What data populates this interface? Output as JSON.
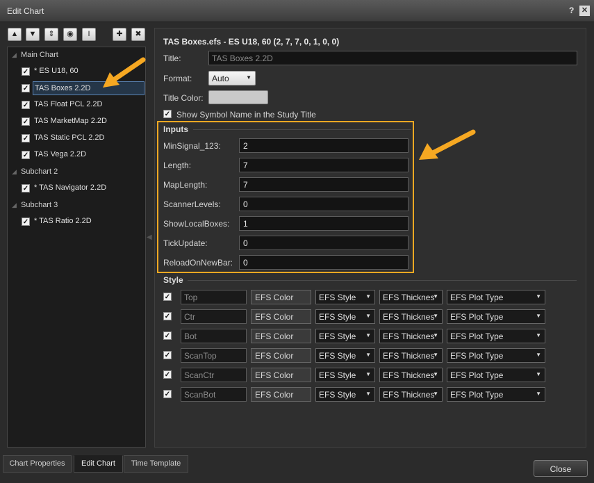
{
  "window": {
    "title": "Edit Chart",
    "help_label": "?",
    "close_label": "✕"
  },
  "toolbar": {
    "buttons": [
      {
        "name": "move-up",
        "glyph": "▲"
      },
      {
        "name": "move-down",
        "glyph": "▼"
      },
      {
        "name": "reorder",
        "glyph": "⇕"
      },
      {
        "name": "view",
        "glyph": "◉"
      },
      {
        "name": "text-cursor",
        "glyph": "I"
      },
      {
        "name": "add",
        "glyph": "✚"
      },
      {
        "name": "remove",
        "glyph": "✖"
      }
    ]
  },
  "tree": {
    "groups": [
      {
        "label": "Main Chart",
        "items": [
          "* ES U18, 60",
          "TAS Boxes 2.2D",
          "TAS Float PCL 2.2D",
          "TAS MarketMap 2.2D",
          "TAS Static PCL 2.2D",
          "TAS Vega 2.2D"
        ]
      },
      {
        "label": "Subchart 2",
        "items": [
          "* TAS Navigator 2.2D"
        ]
      },
      {
        "label": "Subchart 3",
        "items": [
          "* TAS Ratio 2.2D"
        ]
      }
    ],
    "selected": "TAS Boxes 2.2D"
  },
  "study": {
    "heading": "TAS Boxes.efs - ES U18, 60 (2, 7, 7, 0, 1, 0, 0)",
    "title_label": "Title:",
    "title_placeholder": "TAS Boxes 2.2D",
    "format_label": "Format:",
    "format_value": "Auto",
    "title_color_label": "Title Color:",
    "show_symbol_label": "Show Symbol Name in the Study Title"
  },
  "inputs": {
    "section_title": "Inputs",
    "fields": [
      {
        "label": "MinSignal_123:",
        "value": "2"
      },
      {
        "label": "Length:",
        "value": "7"
      },
      {
        "label": "MapLength:",
        "value": "7"
      },
      {
        "label": "ScannerLevels:",
        "value": "0"
      },
      {
        "label": "ShowLocalBoxes:",
        "value": "1"
      },
      {
        "label": "TickUpdate:",
        "value": "0"
      },
      {
        "label": "ReloadOnNewBar:",
        "value": "0"
      }
    ]
  },
  "style": {
    "section_title": "Style",
    "rows": [
      {
        "name": "Top",
        "color": "EFS Color",
        "style": "EFS Style",
        "thickness": "EFS Thicknes",
        "plot_type": "EFS Plot Type"
      },
      {
        "name": "Ctr",
        "color": "EFS Color",
        "style": "EFS Style",
        "thickness": "EFS Thicknes",
        "plot_type": "EFS Plot Type"
      },
      {
        "name": "Bot",
        "color": "EFS Color",
        "style": "EFS Style",
        "thickness": "EFS Thicknes",
        "plot_type": "EFS Plot Type"
      },
      {
        "name": "ScanTop",
        "color": "EFS Color",
        "style": "EFS Style",
        "thickness": "EFS Thicknes",
        "plot_type": "EFS Plot Type"
      },
      {
        "name": "ScanCtr",
        "color": "EFS Color",
        "style": "EFS Style",
        "thickness": "EFS Thicknes",
        "plot_type": "EFS Plot Type"
      },
      {
        "name": "ScanBot",
        "color": "EFS Color",
        "style": "EFS Style",
        "thickness": "EFS Thicknes",
        "plot_type": "EFS Plot Type"
      }
    ]
  },
  "tabs": [
    "Chart Properties",
    "Edit Chart",
    "Time Template"
  ],
  "active_tab": "Edit Chart",
  "close_button": "Close",
  "colors": {
    "highlight": "#f6a822",
    "arrow": "#f6a822",
    "selection": "#253648"
  }
}
